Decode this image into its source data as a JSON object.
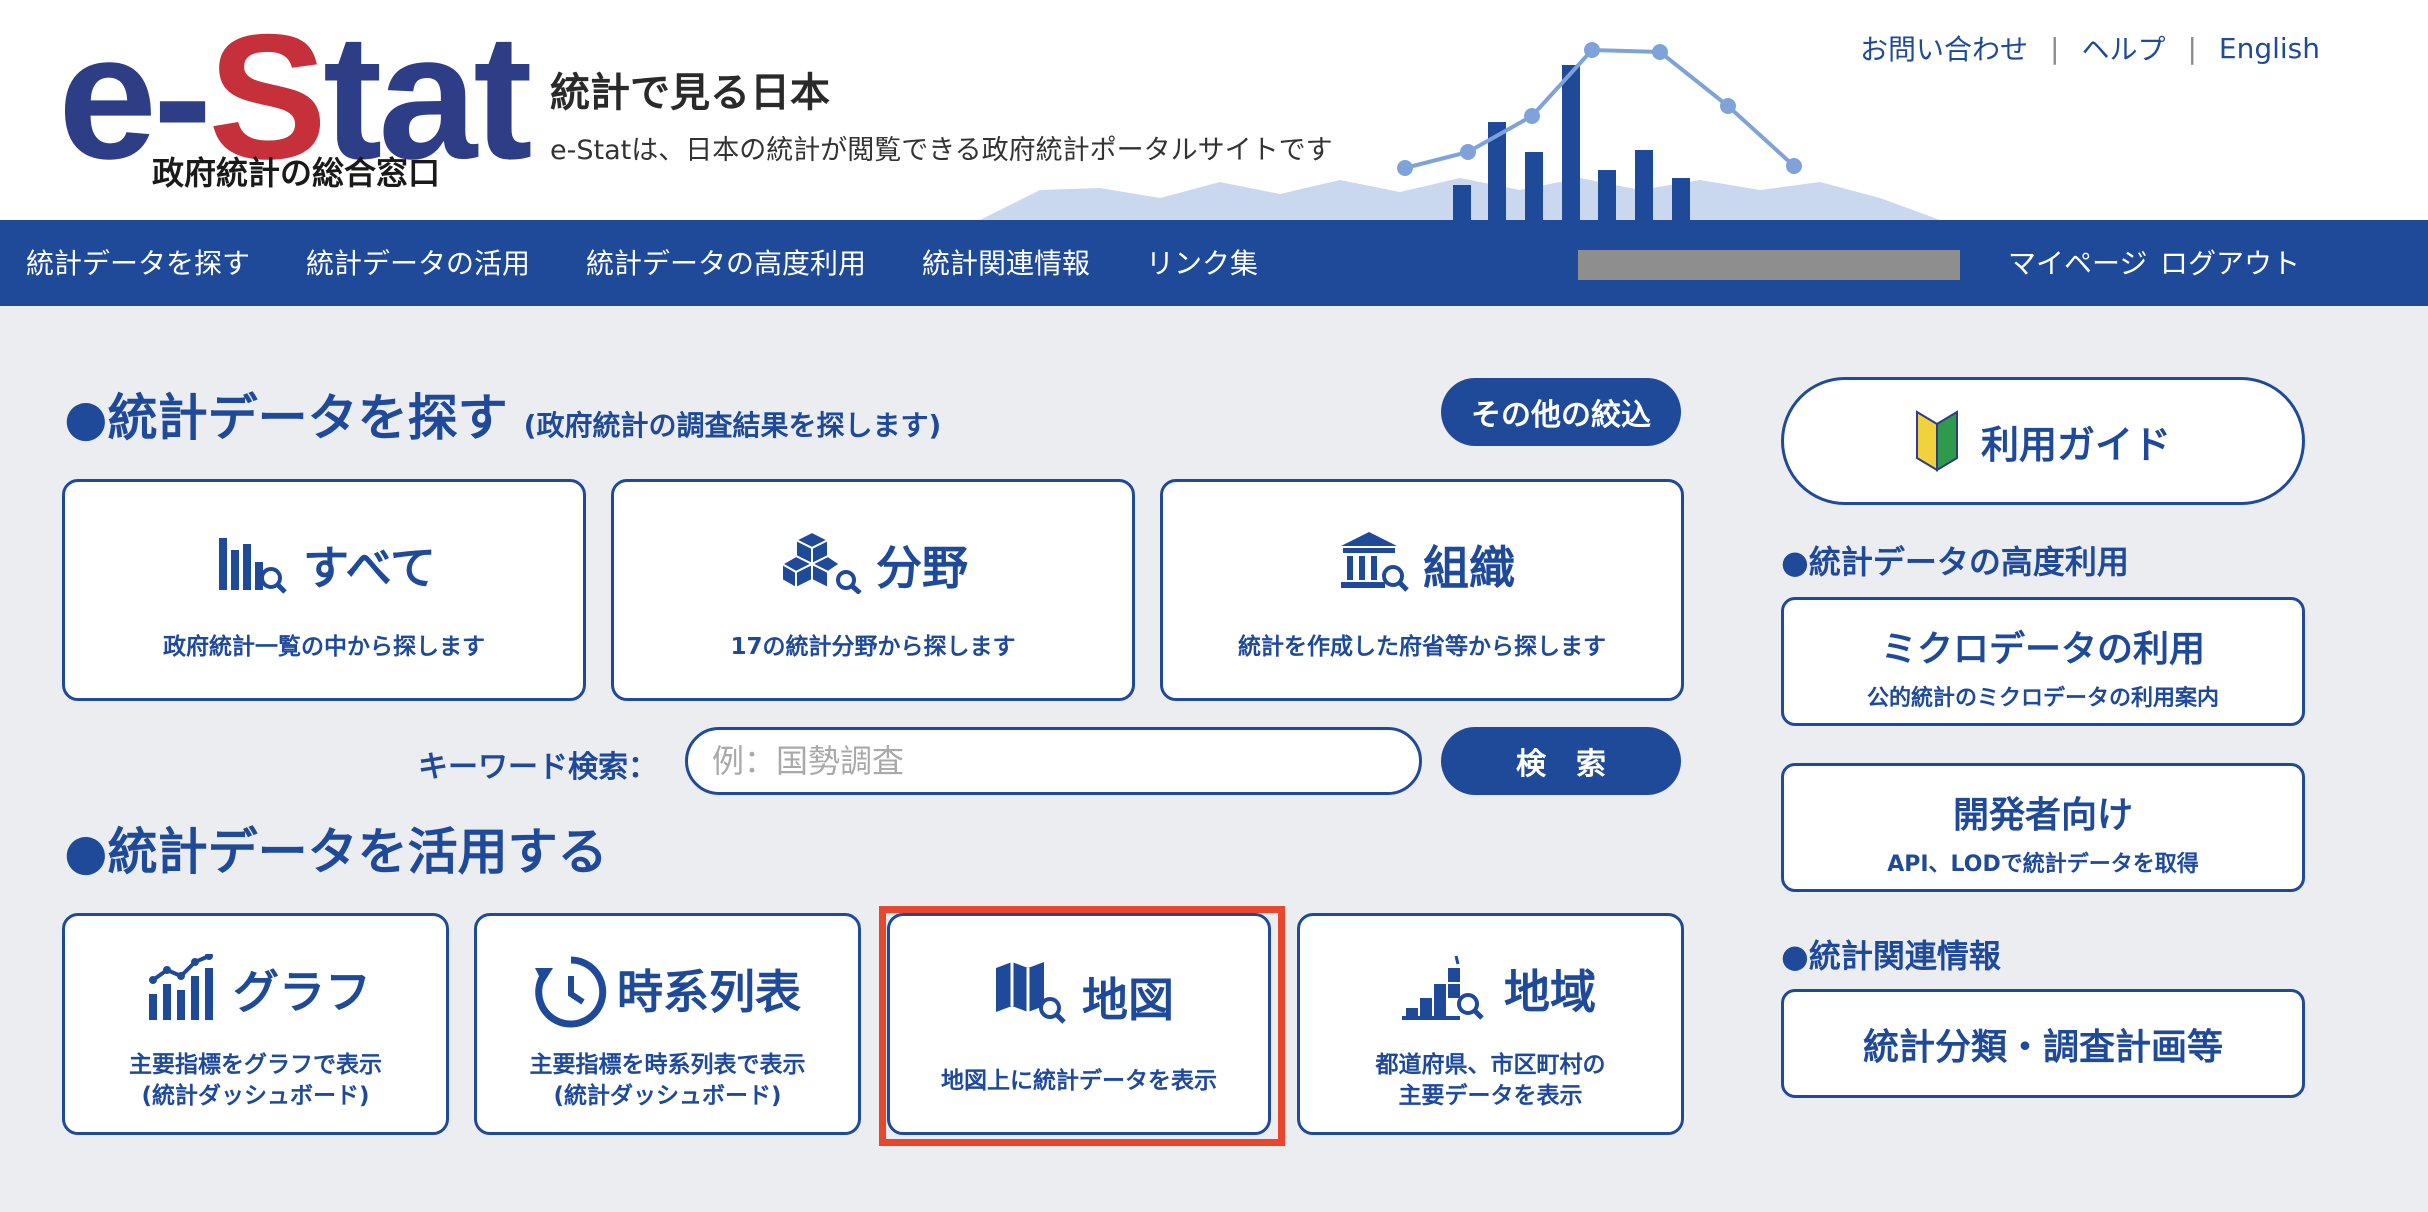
{
  "header": {
    "logo_text_e": "e-",
    "logo_text_s": "S",
    "logo_text_tat": "tat",
    "logo_subtitle": "政府統計の総合窓口",
    "site_title": "統計で見る日本",
    "site_description": "e-Statは、日本の統計が閲覧できる政府統計ポータルサイトです",
    "top_links": [
      "お問い合わせ",
      "ヘルプ",
      "English"
    ],
    "separator": "|"
  },
  "nav": {
    "items": [
      "統計データを探す",
      "統計データの活用",
      "統計データの高度利用",
      "統計関連情報",
      "リンク集"
    ],
    "mypage": "マイページ",
    "logout": "ログアウト"
  },
  "search_section": {
    "heading": "●統計データを探す",
    "subheading": "(政府統計の調査結果を探します)",
    "other_filter_button": "その他の絞込",
    "cards": [
      {
        "title": "すべて",
        "desc": "政府統計一覧の中から探します",
        "icon": "bar-chart-search-icon"
      },
      {
        "title": "分野",
        "desc": "17の統計分野から探します",
        "icon": "cubes-search-icon"
      },
      {
        "title": "組織",
        "desc": "統計を作成した府省等から探します",
        "icon": "building-search-icon"
      }
    ],
    "keyword_label": "キーワード検索：",
    "keyword_placeholder": "例：国勢調査",
    "search_button": "検　索"
  },
  "use_section": {
    "heading": "●統計データを活用する",
    "cards": [
      {
        "title": "グラフ",
        "desc_line1": "主要指標をグラフで表示",
        "desc_line2": "(統計ダッシュボード)",
        "icon": "graph-icon"
      },
      {
        "title": "時系列表",
        "desc_line1": "主要指標を時系列表で表示",
        "desc_line2": "(統計ダッシュボード)",
        "icon": "clock-refresh-icon"
      },
      {
        "title": "地図",
        "desc_line1": "地図上に統計データを表示",
        "desc_line2": "",
        "icon": "map-search-icon"
      },
      {
        "title": "地域",
        "desc_line1": "都道府県、市区町村の",
        "desc_line2": "主要データを表示",
        "icon": "region-stairs-icon"
      }
    ]
  },
  "sidebar": {
    "guide_button": "利用ガイド",
    "advanced_heading": "●統計データの高度利用",
    "micro_title": "ミクロデータの利用",
    "micro_sub": "公的統計のミクロデータの利用案内",
    "dev_title": "開発者向け",
    "dev_sub": "API、LODで統計データを取得",
    "related_heading": "●統計関連情報",
    "classification": "統計分類・調査計画等"
  },
  "colors": {
    "brand_blue": "#1f4a9a",
    "logo_navy": "#2d3d86",
    "logo_red": "#c5303a",
    "highlight": "#e8472e",
    "background": "#ecedf1"
  }
}
